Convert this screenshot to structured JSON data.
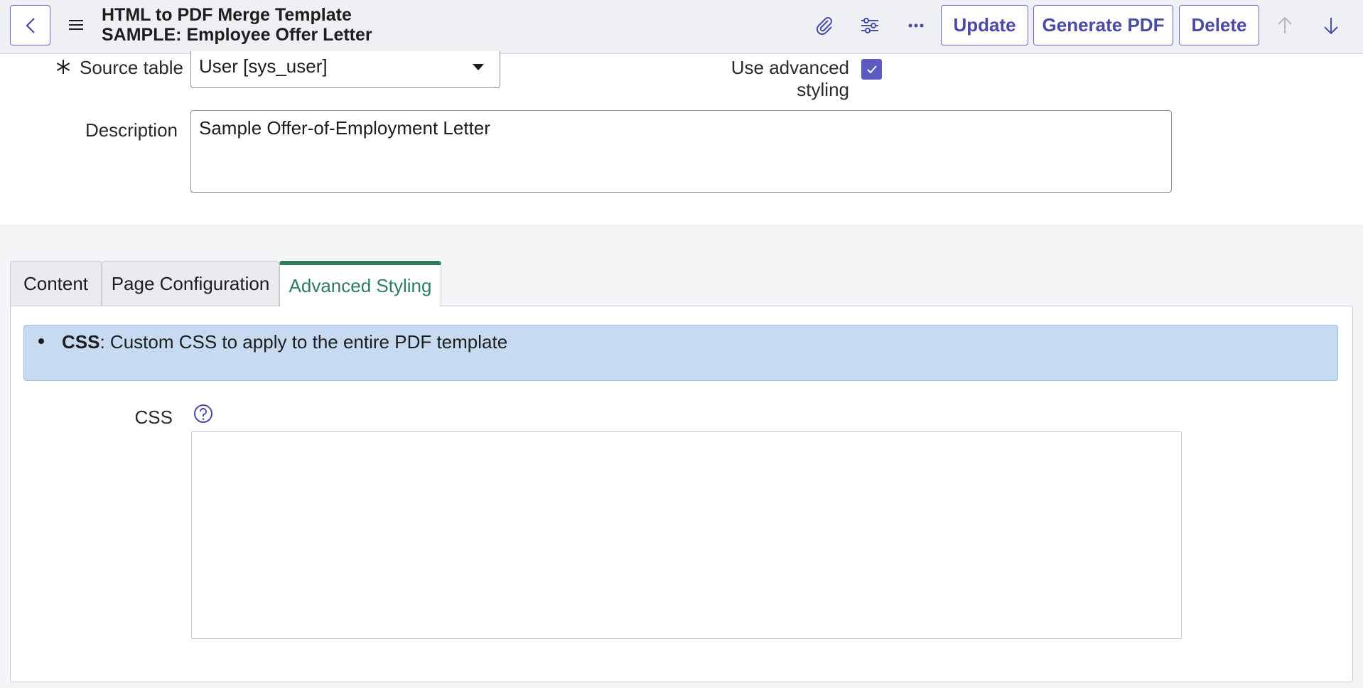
{
  "header": {
    "title_line1": "HTML to PDF Merge Template",
    "title_line2": "SAMPLE: Employee Offer Letter",
    "buttons": {
      "update": "Update",
      "generate_pdf": "Generate PDF",
      "delete": "Delete"
    },
    "icons": [
      "back-arrow-icon",
      "menu-icon",
      "paperclip-icon",
      "sliders-icon",
      "more-icon",
      "arrow-up-icon",
      "arrow-down-icon"
    ]
  },
  "form": {
    "source_table_label": "Source table",
    "source_table_value": "User [sys_user]",
    "use_advanced_label_line1": "Use advanced",
    "use_advanced_label_line2": "styling",
    "use_advanced_checked": true,
    "description_label": "Description",
    "description_value": "Sample Offer-of-Employment Letter"
  },
  "tabs": [
    {
      "label": "Content",
      "active": false
    },
    {
      "label": "Page Configuration",
      "active": false
    },
    {
      "label": "Advanced Styling",
      "active": true
    }
  ],
  "advanced_styling": {
    "info_term": "CSS",
    "info_text": ": Custom CSS to apply to the entire PDF template",
    "css_label": "CSS",
    "css_value": ""
  },
  "colors": {
    "accent": "#4a4aa8",
    "active_tab": "#2e7d5b",
    "info_bg": "#c6dbf1",
    "checkbox": "#5d5bc2"
  }
}
